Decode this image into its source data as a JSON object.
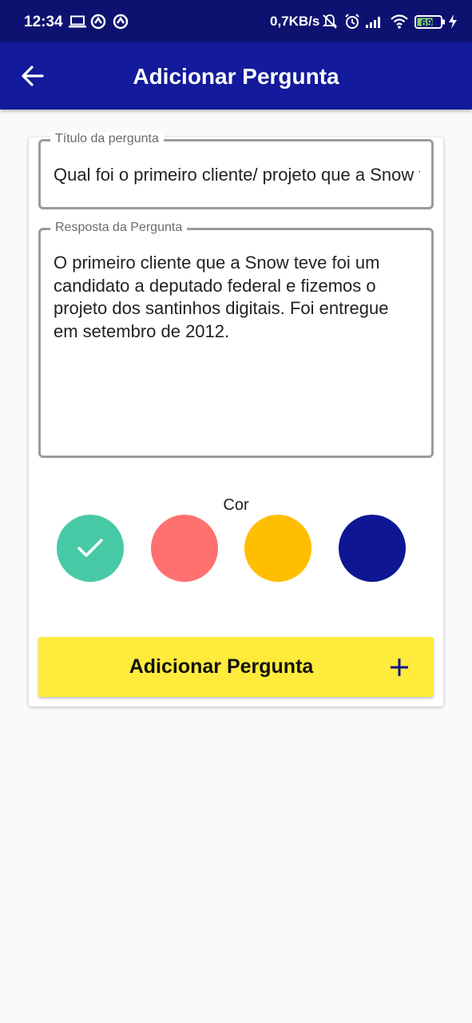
{
  "status_bar": {
    "time": "12:34",
    "network_speed": "0,7KB/s",
    "battery": "69",
    "icons": [
      "laptop-icon",
      "sync-icon",
      "sync-icon",
      "mute-icon",
      "alarm-icon",
      "signal-icon",
      "wifi-icon",
      "battery-icon",
      "charging-icon"
    ]
  },
  "app_bar": {
    "title": "Adicionar Pergunta",
    "back_icon": "arrow-left-icon",
    "color": "#131a9b"
  },
  "form": {
    "title_field": {
      "label": "Título da pergunta",
      "value": "Qual foi o primeiro cliente/ projeto que a Snow teve?"
    },
    "answer_field": {
      "label": "Resposta da Pergunta",
      "value": "O primeiro cliente que a Snow teve foi um candidato a deputado federal e fizemos o projeto dos santinhos digitais. Foi entregue em setembro de 2012."
    },
    "color_label": "Cor",
    "colors": [
      {
        "hex": "#48c9a6",
        "selected": true
      },
      {
        "hex": "#ff7070",
        "selected": false
      },
      {
        "hex": "#ffbf00",
        "selected": false
      },
      {
        "hex": "#0f1693",
        "selected": false
      }
    ],
    "submit_label": "Adicionar Pergunta",
    "submit_icon": "plus-icon",
    "submit_color": "#ffeb3b"
  }
}
